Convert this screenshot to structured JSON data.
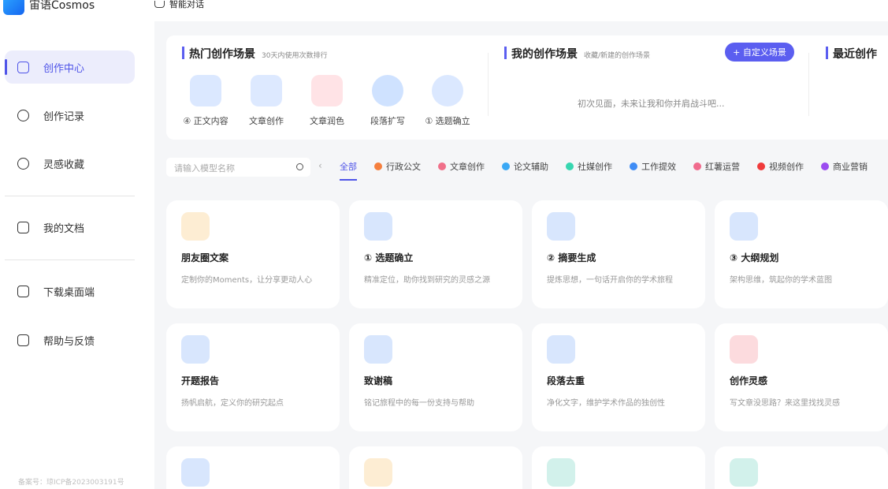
{
  "header": {
    "brand": "宙语Cosmos",
    "chat_label": "智能对话"
  },
  "sidebar": {
    "items": [
      {
        "label": "创作中心",
        "icon": "home-icon",
        "active": true
      },
      {
        "label": "创作记录",
        "icon": "cloud-icon"
      },
      {
        "label": "灵感收藏",
        "icon": "lightbulb-icon"
      },
      {
        "label": "我的文档",
        "icon": "book-icon"
      },
      {
        "label": "下载桌面端",
        "icon": "monitor-icon"
      },
      {
        "label": "帮助与反馈",
        "icon": "mail-icon"
      }
    ],
    "footer": "备案号：琼ICP备2023003191号"
  },
  "hot": {
    "title": "热门创作场景",
    "subtitle": "30天内使用次数排行",
    "items": [
      {
        "label": "④ 正文内容",
        "color": "#3b82f6"
      },
      {
        "label": "文章创作",
        "color": "#3b82f6"
      },
      {
        "label": "文章润色",
        "color": "#f04a5a"
      },
      {
        "label": "段落扩写",
        "color": "#2f80ed"
      },
      {
        "label": "① 选题确立",
        "color": "#3b82f6"
      }
    ]
  },
  "mine": {
    "title": "我的创作场景",
    "subtitle": "收藏/新建的创作场景",
    "custom_button": "+ 自定义场景",
    "empty_text": "初次见面，未来让我和你并肩战斗吧..."
  },
  "recent": {
    "title": "最近创作"
  },
  "filter": {
    "search_placeholder": "请输入模型名称",
    "tabs": [
      {
        "label": "全部",
        "active": true
      },
      {
        "label": "行政公文",
        "color": "#f57f3e"
      },
      {
        "label": "文章创作",
        "color": "#f0708a"
      },
      {
        "label": "论文辅助",
        "color": "#3aa8f5"
      },
      {
        "label": "社媒创作",
        "color": "#37d6b0"
      },
      {
        "label": "工作提效",
        "color": "#3f8cf5"
      },
      {
        "label": "红薯运营",
        "color": "#f06b8d"
      },
      {
        "label": "视频创作",
        "color": "#f03b3b"
      },
      {
        "label": "商业营销",
        "color": "#9b4cf0"
      }
    ]
  },
  "cards": [
    {
      "title": "朋友圈文案",
      "desc": "定制你的Moments，让分享更动人心",
      "color": "#f5a623"
    },
    {
      "title": "① 选题确立",
      "desc": "精准定位，助你找到研究的灵感之源",
      "color": "#3b82f6"
    },
    {
      "title": "② 摘要生成",
      "desc": "提炼思想，一句话开启你的学术旅程",
      "color": "#3b82f6"
    },
    {
      "title": "③ 大纲规划",
      "desc": "架构思维，筑起你的学术蓝图",
      "color": "#3b82f6"
    },
    {
      "title": "开题报告",
      "desc": "扬帆启航，定义你的研究起点",
      "color": "#3b82f6"
    },
    {
      "title": "致谢稿",
      "desc": "铭记旅程中的每一份支持与帮助",
      "color": "#3b82f6"
    },
    {
      "title": "段落去重",
      "desc": "净化文字，维护学术作品的独创性",
      "color": "#3b82f6"
    },
    {
      "title": "创作灵感",
      "desc": "写文章没思路？来这里找找灵感",
      "color": "#f04a5a"
    },
    {
      "title": "",
      "desc": "",
      "color": "#3b82f6"
    },
    {
      "title": "",
      "desc": "",
      "color": "#f5a623"
    },
    {
      "title": "",
      "desc": "",
      "color": "#1fb89a"
    },
    {
      "title": "",
      "desc": "",
      "color": "#1fb89a"
    }
  ]
}
